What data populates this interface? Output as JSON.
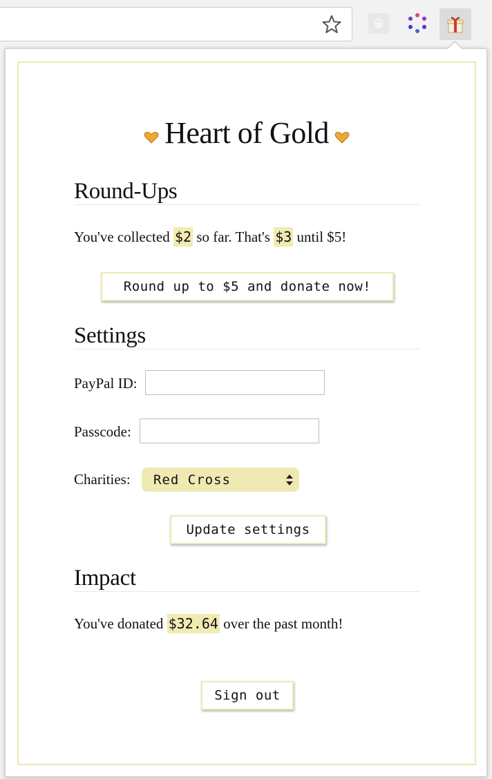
{
  "popup": {
    "title": "Heart of Gold",
    "roundups": {
      "heading": "Round-Ups",
      "text_a": "You've collected ",
      "collected": "$2",
      "text_b": " so far. That's ",
      "remaining": "$3",
      "text_c": " until $5!",
      "button_label": "Round up to $5 and donate now!"
    },
    "settings": {
      "heading": "Settings",
      "paypal_label": "PayPal ID:",
      "paypal_value": "",
      "passcode_label": "Passcode:",
      "passcode_value": "",
      "charities_label": "Charities:",
      "charity_selected": "Red Cross",
      "update_label": "Update settings"
    },
    "impact": {
      "heading": "Impact",
      "text_a": "You've donated ",
      "amount": "$32.64",
      "text_b": " over the past month!"
    },
    "signout_label": "Sign out"
  },
  "colors": {
    "accent_gold": "#efe9b4",
    "highlight": "#f1ebb1",
    "heart": "#f0a830"
  },
  "icons": [
    "star-icon",
    "ghost-extension-icon",
    "dots-extension-icon",
    "gift-extension-icon",
    "heart-icon",
    "select-arrows-icon"
  ]
}
